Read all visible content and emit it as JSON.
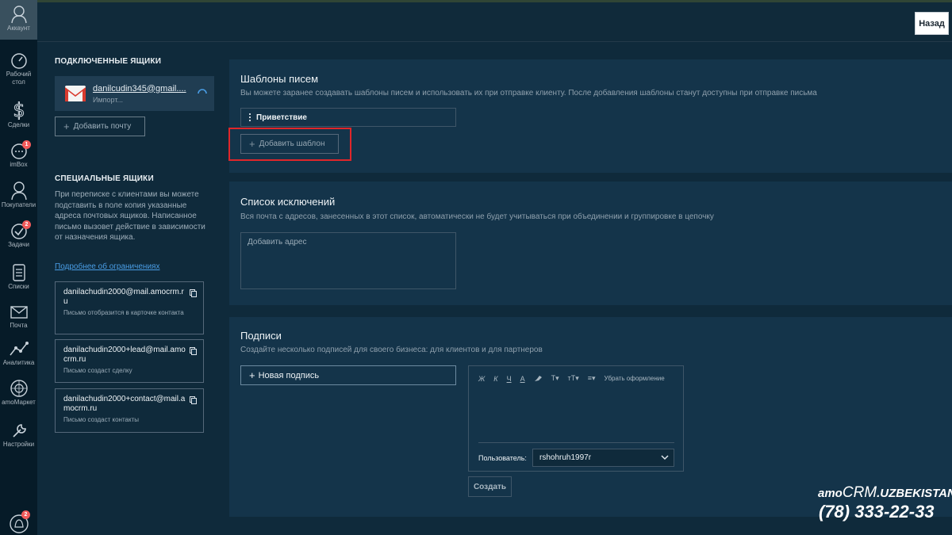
{
  "nav": {
    "account_label": "Аккаунт",
    "items": [
      {
        "label": "Рабочий стол",
        "icon": "dashboard-icon"
      },
      {
        "label": "Сделки",
        "icon": "dollar-icon"
      },
      {
        "label": "imBox",
        "icon": "chat-icon",
        "badge": "1"
      },
      {
        "label": "Покупатели",
        "icon": "customers-icon"
      },
      {
        "label": "Задачи",
        "icon": "check-icon",
        "badge": "2"
      },
      {
        "label": "Списки",
        "icon": "lists-icon"
      },
      {
        "label": "Почта",
        "icon": "mail-icon"
      },
      {
        "label": "Аналитика",
        "icon": "analytics-icon"
      },
      {
        "label": "amoМаркет",
        "icon": "market-icon"
      },
      {
        "label": "Настройки",
        "icon": "settings-icon"
      }
    ],
    "notifications_badge": "2"
  },
  "topbar": {
    "back_label": "Назад"
  },
  "left": {
    "connected_title": "ПОДКЛЮЧЕННЫЕ ЯЩИКИ",
    "mailbox": {
      "email": "danilcudin345@gmail....",
      "status": "Импорт..."
    },
    "add_mail_label": "Добавить почту",
    "special_title": "СПЕЦИАЛЬНЫЕ ЯЩИКИ",
    "special_desc": "При переписке с клиентами вы можете подставить в поле копия указанные адреса почтовых ящиков. Написанное письмо вызовет действие в зависимости от назначения ящика.",
    "special_link": "Подробнее об ограничениях",
    "special_boxes": [
      {
        "email": "danilachudin2000@mail.amocrm.ru",
        "desc": "Письмо отобразится в карточке контакта"
      },
      {
        "email": "danilachudin2000+lead@mail.amocrm.ru",
        "desc": "Письмо создаст сделку"
      },
      {
        "email": "danilachudin2000+contact@mail.amocrm.ru",
        "desc": "Письмо создаст контакты"
      }
    ]
  },
  "templates": {
    "title": "Шаблоны писем",
    "desc": "Вы можете заранее создавать шаблоны писем и использовать их при отправке клиенту. После добавления шаблоны станут доступны при отправке письма",
    "item": "Приветствие",
    "add_label": "Добавить шаблон"
  },
  "exclusions": {
    "title": "Список исключений",
    "desc": "Вся почта с адресов, занесенных в этот список, автоматически не будет учитываться при объединении и группировке в цепочку",
    "placeholder": "Добавить адрес"
  },
  "signatures": {
    "title": "Подписи",
    "desc": "Создайте несколько подписей для своего бизнеса: для клиентов и для партнеров",
    "new_label": "Новая подпись",
    "toolbar": [
      "Ж",
      "К",
      "Ч",
      "А",
      "T▾",
      "тТ▾",
      "≡▾"
    ],
    "clear_format": "Убрать оформление",
    "user_label": "Пользователь:",
    "user_value": "rshohruh1997r",
    "create_label": "Создать"
  },
  "watermark": {
    "brand_prefix": "amo",
    "brand_crm": "CRM",
    "brand_suffix": ".UZBEKISTAN",
    "phone": "(78) 333-22-33"
  },
  "colors": {
    "background": "#0f2a3b",
    "nav": "#061b28",
    "card": "#14344a",
    "highlight": "#e0262a",
    "link": "#4a9ee6",
    "badge": "#f15a5a"
  }
}
